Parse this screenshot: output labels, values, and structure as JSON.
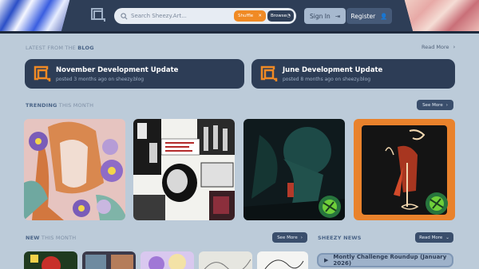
{
  "header": {
    "search_placeholder": "Search Sheezy.Art...",
    "shuffle_label": "Shuffle",
    "browse_label": "Browse",
    "signin_label": "Sign In",
    "register_label": "Register",
    "brand_color": "#2e3e57",
    "accent_color": "#f08a24"
  },
  "blog": {
    "title_prefix": "LATEST FROM THE ",
    "title_highlight": "BLOG",
    "read_more": "Read More",
    "posts": [
      {
        "title": "November Development Update",
        "meta": "posted 3 months ago on sheezy.blog"
      },
      {
        "title": "June Development Update",
        "meta": "posted 8 months ago on sheezy.blog"
      }
    ]
  },
  "trending": {
    "title_highlight": "TRENDING",
    "title_suffix": " THIS MONTH",
    "see_more": "See More",
    "artworks": [
      "floral-portrait",
      "black-white-collage",
      "dark-teal-scene",
      "orange-character-poster"
    ]
  },
  "new": {
    "title_highlight": "NEW",
    "title_suffix": " THIS MONTH",
    "see_more": "See More"
  },
  "news": {
    "title": "SHEEZY NEWS",
    "read_more": "Read More",
    "item_title": "Montly Challenge Roundup (January 2026)"
  }
}
